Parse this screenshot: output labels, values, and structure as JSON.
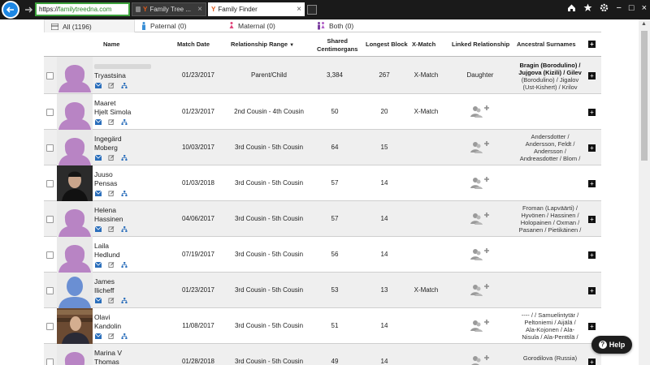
{
  "browser": {
    "url_prefix": "https://",
    "url_host": "familytreedna.com",
    "tabs": [
      {
        "label": "Family Tree ...",
        "close": "×"
      },
      {
        "label": "Family Finder",
        "close": "×"
      }
    ],
    "right_icons": [
      "home-icon",
      "star-icon",
      "gear-icon"
    ],
    "window_controls": [
      "−",
      "□",
      "×"
    ]
  },
  "filter_tabs": [
    {
      "label": "All (1196)",
      "icon": "list-icon",
      "active": true
    },
    {
      "label": "Paternal (0)",
      "icon": "male-icon",
      "active": false
    },
    {
      "label": "Maternal (0)",
      "icon": "female-icon",
      "active": false
    },
    {
      "label": "Both (0)",
      "icon": "couple-icon",
      "active": false
    }
  ],
  "colors": {
    "female_avatar": "#b884c4",
    "male_avatar": "#6a8fd3",
    "action_icon": "#2a6ebb",
    "url_border": "#3da23d",
    "back_button": "#1e88e5"
  },
  "columns": {
    "name": "Name",
    "match_date": "Match Date",
    "relationship_range": "Relationship Range",
    "shared_cm": [
      "Shared",
      "Centimorgans"
    ],
    "longest_block": "Longest Block",
    "x_match": "X-Match",
    "linked_relationship": "Linked Relationship",
    "ancestral_surnames": "Ancestral Surnames",
    "sort_indicator": "▼",
    "expand": "+"
  },
  "rows": [
    {
      "name_lines": [
        "",
        "Tryastsina"
      ],
      "avatar": "female",
      "match_date": "01/23/2017",
      "relationship": "Parent/Child",
      "shared_cm": "3,384",
      "longest_block": "267",
      "x_match": "X-Match",
      "linked": "Daughter",
      "surnames_lines": [
        "Bragin (Borodulino) /",
        "Jujgova (Kizili) / Gilev",
        "(Borodulino) / Jigalov",
        "(Ust-Kishert) / Krilov"
      ]
    },
    {
      "name_lines": [
        "Maaret",
        "Hjelt Simola"
      ],
      "avatar": "female",
      "match_date": "01/23/2017",
      "relationship": "2nd Cousin - 4th Cousin",
      "shared_cm": "50",
      "longest_block": "20",
      "x_match": "X-Match",
      "linked": "",
      "surnames_lines": []
    },
    {
      "name_lines": [
        "Ingegärd",
        "Moberg"
      ],
      "avatar": "female",
      "match_date": "10/03/2017",
      "relationship": "3rd Cousin - 5th Cousin",
      "shared_cm": "64",
      "longest_block": "15",
      "x_match": "",
      "linked": "",
      "surnames_lines": [
        "Andersdotter /",
        "Andersson, Feldt /",
        "Andersson /",
        "Andreasdotter / Blom /"
      ]
    },
    {
      "name_lines": [
        "Juuso",
        "Pensas"
      ],
      "avatar": "photo-dark",
      "match_date": "01/03/2018",
      "relationship": "3rd Cousin - 5th Cousin",
      "shared_cm": "57",
      "longest_block": "14",
      "x_match": "",
      "linked": "",
      "surnames_lines": []
    },
    {
      "name_lines": [
        "Helena",
        "Hassinen"
      ],
      "avatar": "female",
      "match_date": "04/06/2017",
      "relationship": "3rd Cousin - 5th Cousin",
      "shared_cm": "57",
      "longest_block": "14",
      "x_match": "",
      "linked": "",
      "surnames_lines": [
        "Froman (Lapväärti) /",
        "Hyvönen / Hassinen /",
        "Holopainen / Oxman /",
        "Pasanen / Pietikäinen /"
      ]
    },
    {
      "name_lines": [
        "Laila",
        "Hedlund"
      ],
      "avatar": "female",
      "match_date": "07/19/2017",
      "relationship": "3rd Cousin - 5th Cousin",
      "shared_cm": "56",
      "longest_block": "14",
      "x_match": "",
      "linked": "",
      "surnames_lines": []
    },
    {
      "name_lines": [
        "James",
        "Ilicheff"
      ],
      "avatar": "male",
      "match_date": "01/23/2017",
      "relationship": "3rd Cousin - 5th Cousin",
      "shared_cm": "53",
      "longest_block": "13",
      "x_match": "X-Match",
      "linked": "",
      "surnames_lines": []
    },
    {
      "name_lines": [
        "Olavi",
        "Kandolin"
      ],
      "avatar": "photo-books",
      "match_date": "11/08/2017",
      "relationship": "3rd Cousin - 5th Cousin",
      "shared_cm": "51",
      "longest_block": "14",
      "x_match": "",
      "linked": "",
      "surnames_lines": [
        "---- / / Samuelintytär /",
        "Peltoniemi / Aijälä /",
        "Ala-Kojonen / Ala-",
        "Nisula / Ala-Penttilä /"
      ]
    },
    {
      "name_lines": [
        "Marina V",
        "Thomas"
      ],
      "avatar": "female",
      "match_date": "01/28/2018",
      "relationship": "3rd Cousin - 5th Cousin",
      "shared_cm": "49",
      "longest_block": "14",
      "x_match": "",
      "linked": "",
      "surnames_lines": [
        "Gorodilova (Russia)",
        ""
      ]
    }
  ],
  "help_label": "Help"
}
